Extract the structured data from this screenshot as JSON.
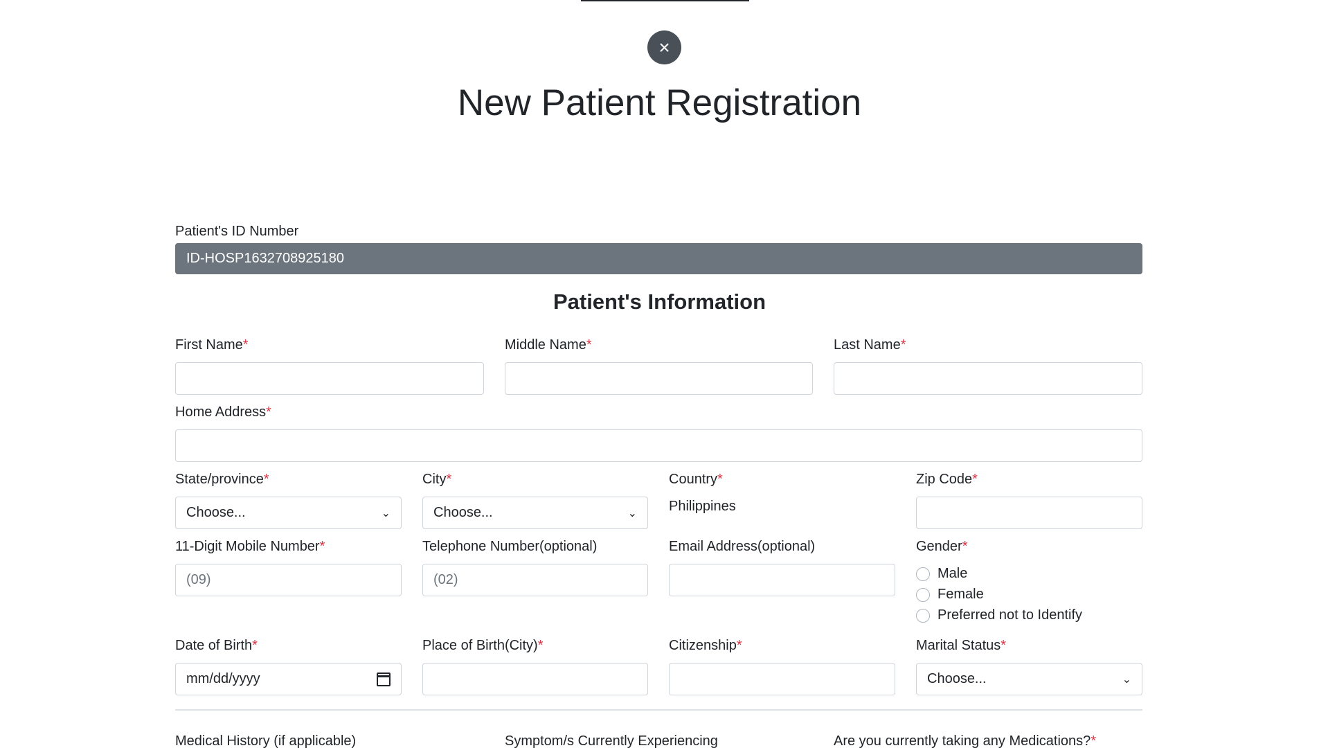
{
  "header": {
    "close_symbol": "×",
    "title": "New Patient Registration"
  },
  "patient_id": {
    "label": "Patient's ID Number",
    "value": "ID-HOSP1632708925180"
  },
  "section_title": "Patient's Information",
  "required_mark": "*",
  "fields": {
    "first_name": {
      "label": "First Name",
      "value": ""
    },
    "middle_name": {
      "label": "Middle Name",
      "value": ""
    },
    "last_name": {
      "label": "Last Name",
      "value": ""
    },
    "home_address": {
      "label": "Home Address",
      "value": ""
    },
    "state": {
      "label": "State/province",
      "selected": "Choose..."
    },
    "city": {
      "label": "City",
      "selected": "Choose..."
    },
    "country": {
      "label": "Country",
      "value": "Philippines"
    },
    "zip": {
      "label": "Zip Code",
      "value": ""
    },
    "mobile": {
      "label": "11-Digit Mobile Number",
      "placeholder": "(09)"
    },
    "telephone": {
      "label": "Telephone Number(optional)",
      "placeholder": "(02)"
    },
    "email": {
      "label": "Email Address(optional)",
      "value": ""
    },
    "gender": {
      "label": "Gender",
      "options": [
        "Male",
        "Female",
        "Preferred not to Identify"
      ]
    },
    "dob": {
      "label": "Date of Birth",
      "placeholder": "mm/dd/yyyy"
    },
    "place_of_birth": {
      "label": "Place of Birth(City)",
      "value": ""
    },
    "citizenship": {
      "label": "Citizenship",
      "value": ""
    },
    "marital_status": {
      "label": "Marital Status",
      "selected": "Choose..."
    }
  },
  "next_section": {
    "medical_history": "Medical History (if applicable)",
    "symptoms": "Symptom/s Currently Experiencing",
    "medications": "Are you currently taking any Medications?"
  },
  "icons": {
    "close": "close-icon",
    "chevron": "chevron-down-icon",
    "calendar": "calendar-icon"
  },
  "colors": {
    "id_field_bg": "#6c757d",
    "required": "#dc3545",
    "close_button": "#495057"
  }
}
